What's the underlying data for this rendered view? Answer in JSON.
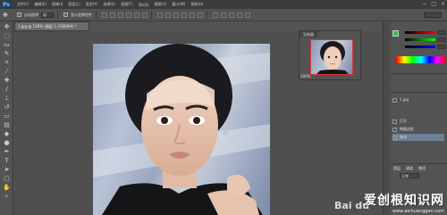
{
  "app": {
    "logo_text": "Ps"
  },
  "menu": {
    "items": [
      "文件(F)",
      "编辑(E)",
      "图像(I)",
      "图层(L)",
      "类型(Y)",
      "选择(S)",
      "滤镜(T)",
      "3D(D)",
      "视图(V)",
      "窗口(W)",
      "帮助(H)"
    ]
  },
  "window_controls": [
    "−",
    "□",
    "×"
  ],
  "options_bar": {
    "auto_select_label": "自动选择",
    "auto_select_value": "组",
    "show_transform_label": "显示变换控件"
  },
  "document": {
    "tab_title": "1.jpg @ 100% (图层 1, RGB/8#) *"
  },
  "navigator": {
    "tab_label": "导航器",
    "zoom": "100%"
  },
  "layers": {
    "items": [
      {
        "name": "1.jpg",
        "selected": false
      },
      {
        "name": "打开",
        "selected": false
      },
      {
        "name": "椭圆选框",
        "selected": false
      },
      {
        "name": "移动",
        "selected": true
      }
    ]
  },
  "channels": {
    "tabs": [
      "图层",
      "通道",
      "路径"
    ],
    "blend_mode": "正常"
  },
  "watermark": {
    "cn": "爱创根知识网",
    "en": "www.aichuanggen.com",
    "baidu": "Bai du"
  },
  "colors": {
    "foreground": "#29c93a",
    "background": "#ffffff",
    "selection": "#6d7f98"
  }
}
